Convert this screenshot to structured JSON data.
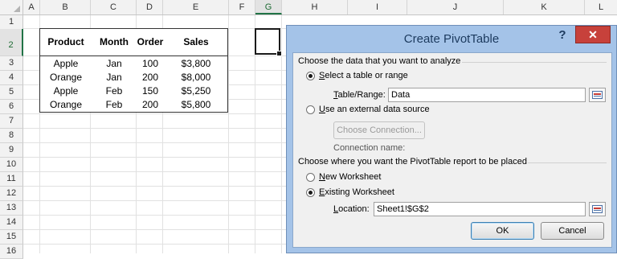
{
  "sheet": {
    "columns": [
      "A",
      "B",
      "C",
      "D",
      "E",
      "F",
      "G",
      "H",
      "I",
      "J",
      "K",
      "L"
    ],
    "active_column": "G",
    "rows": [
      "1",
      "2",
      "3",
      "4",
      "5",
      "6",
      "7",
      "8",
      "9",
      "10",
      "11",
      "12",
      "13",
      "14",
      "15",
      "16"
    ],
    "active_row": "2",
    "table": {
      "headers": [
        "Product",
        "Month",
        "Order",
        "Sales"
      ],
      "rows": [
        [
          "Apple",
          "Jan",
          "100",
          "$3,800"
        ],
        [
          "Orange",
          "Jan",
          "200",
          "$8,000"
        ],
        [
          "Apple",
          "Feb",
          "150",
          "$5,250"
        ],
        [
          "Orange",
          "Feb",
          "200",
          "$5,800"
        ]
      ]
    }
  },
  "dialog": {
    "title": "Create PivotTable",
    "help": "?",
    "close": "✕",
    "section1": "Choose the data that you want to analyze",
    "opt_select_range": {
      "key": "S",
      "rest": "elect a table or range",
      "checked": true
    },
    "table_range": {
      "key": "T",
      "rest": "able/Range:",
      "value": "Data"
    },
    "opt_external": {
      "key": "U",
      "rest": "se an external data source",
      "checked": false
    },
    "choose_connection": "Choose Connection...",
    "connection_name": "Connection name:",
    "section2": "Choose where you want the PivotTable report to be placed",
    "opt_new_ws": {
      "key": "N",
      "rest": "ew Worksheet",
      "checked": false
    },
    "opt_existing_ws": {
      "key": "E",
      "rest": "xisting Worksheet",
      "checked": true
    },
    "location": {
      "key": "L",
      "rest": "ocation:",
      "value": "Sheet1!$G$2"
    },
    "ok": "OK",
    "cancel": "Cancel"
  }
}
